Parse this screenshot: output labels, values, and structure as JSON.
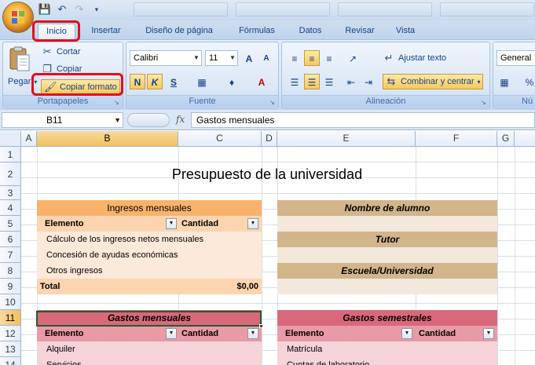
{
  "titlebar": {
    "qat": [
      "save-icon",
      "undo-icon",
      "redo-icon",
      "customize-icon"
    ]
  },
  "tabs": [
    "Inicio",
    "Insertar",
    "Diseño de página",
    "Fórmulas",
    "Datos",
    "Revisar",
    "Vista"
  ],
  "ribbon": {
    "portapapeles": {
      "label": "Portapapeles",
      "paste": "Pegar",
      "cut": "Cortar",
      "copy": "Copiar",
      "format_painter": "Copiar formato"
    },
    "fuente": {
      "label": "Fuente",
      "font_name": "Calibri",
      "font_size": "11",
      "grow": "A",
      "shrink": "A",
      "bold": "N",
      "italic": "K",
      "underline": "S",
      "fill": "A",
      "color": "A"
    },
    "alineacion": {
      "label": "Alineación",
      "wrap": "Ajustar texto",
      "merge": "Combinar y centrar"
    },
    "numero": {
      "label": "Nú",
      "format": "General",
      "percent": "%"
    }
  },
  "formula_bar": {
    "name_box": "B11",
    "fx": "fx",
    "content": "Gastos mensuales"
  },
  "columns": [
    "A",
    "B",
    "C",
    "D",
    "E",
    "F",
    "G"
  ],
  "rows": [
    "1",
    "2",
    "3",
    "4",
    "5",
    "6",
    "7",
    "8",
    "9",
    "10",
    "11",
    "12",
    "13",
    "14"
  ],
  "sheet": {
    "title": "Presupuesto de la universidad",
    "ingresos": {
      "header": "Ingresos mensuales",
      "col_elemento": "Elemento",
      "col_cantidad": "Cantidad",
      "items": [
        "Cálculo de los ingresos netos mensuales",
        "Concesión de ayudas económicas",
        "Otros ingresos"
      ],
      "total_label": "Total",
      "total_value": "$0,00"
    },
    "info": {
      "nombre": "Nombre de alumno",
      "tutor": "Tutor",
      "escuela": "Escuela/Universidad"
    },
    "gastos_mensuales": {
      "header": "Gastos mensuales",
      "col_elemento": "Elemento",
      "col_cantidad": "Cantidad",
      "items": [
        "Alquiler",
        "Servicios"
      ]
    },
    "gastos_semestrales": {
      "header": "Gastos semestrales",
      "col_elemento": "Elemento",
      "col_cantidad": "Cantidad",
      "items": [
        "Matrícula",
        "Cuotas de laboratorio"
      ]
    }
  },
  "colors": {
    "orange": "#f9b26b",
    "orange_light": "#fde9d9",
    "tan": "#d3b58c",
    "tan_light": "#f2e9dc",
    "rose": "#d9697a",
    "rose_light": "#f5d3d8",
    "highlight": "#e0101a"
  }
}
